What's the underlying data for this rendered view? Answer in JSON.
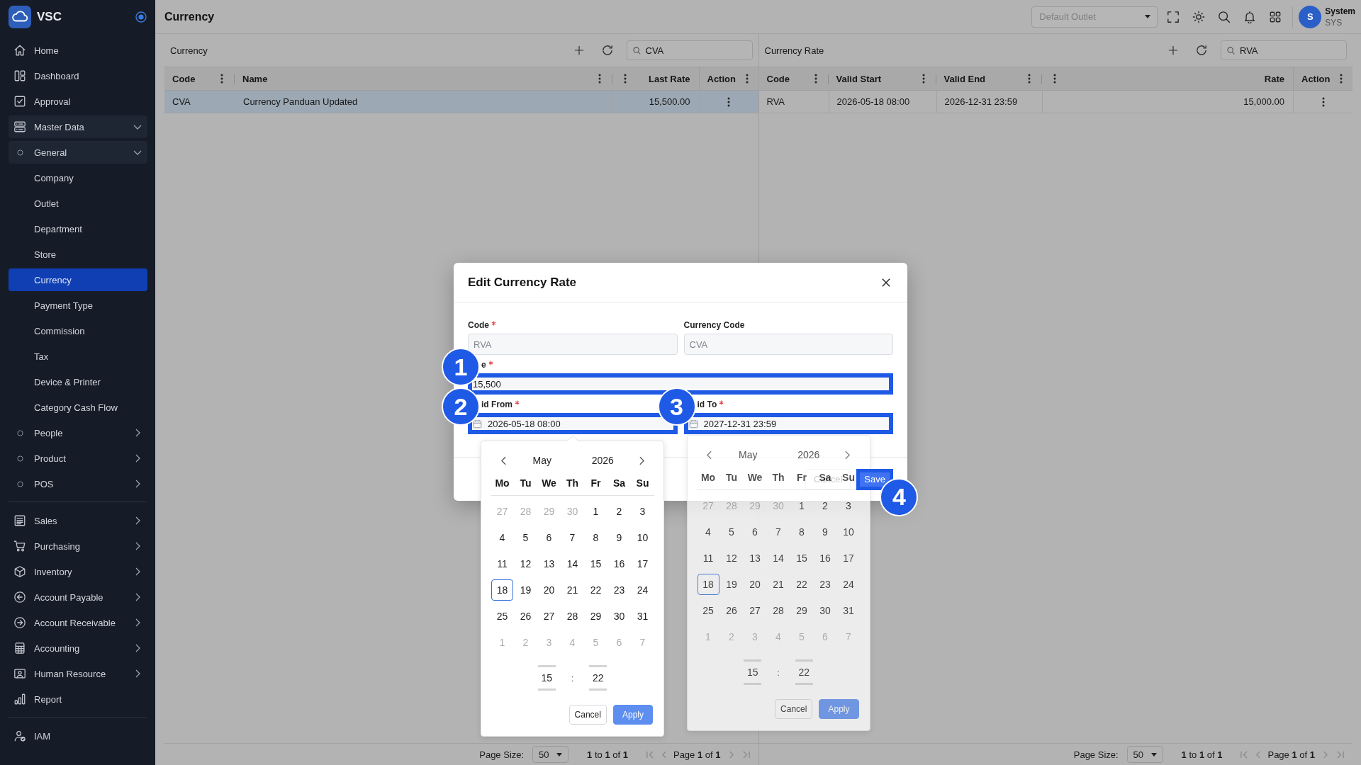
{
  "sidebar": {
    "brand": "VSC",
    "sections": [
      [
        {
          "label": "Home",
          "kind": "link",
          "selected": false
        },
        {
          "label": "Dashboard",
          "kind": "link",
          "selected": false
        },
        {
          "label": "Approval",
          "kind": "link",
          "selected": false
        },
        {
          "label": "Master Data",
          "kind": "group",
          "expanded": true,
          "children": [
            {
              "label": "General",
              "kind": "group",
              "expanded": true,
              "children": [
                {
                  "label": "Company",
                  "kind": "link",
                  "selected": false
                },
                {
                  "label": "Outlet",
                  "kind": "link",
                  "selected": false
                },
                {
                  "label": "Department",
                  "kind": "link",
                  "selected": false
                },
                {
                  "label": "Store",
                  "kind": "link",
                  "selected": false
                },
                {
                  "label": "Currency",
                  "kind": "link",
                  "selected": true
                },
                {
                  "label": "Payment Type",
                  "kind": "link",
                  "selected": false
                },
                {
                  "label": "Commission",
                  "kind": "link",
                  "selected": false
                },
                {
                  "label": "Tax",
                  "kind": "link",
                  "selected": false
                },
                {
                  "label": "Device & Printer",
                  "kind": "link",
                  "selected": false
                },
                {
                  "label": "Category Cash Flow",
                  "kind": "link",
                  "selected": false
                }
              ]
            },
            {
              "label": "People",
              "kind": "group",
              "expanded": false
            },
            {
              "label": "Product",
              "kind": "group",
              "expanded": false
            },
            {
              "label": "POS",
              "kind": "group",
              "expanded": false
            }
          ]
        }
      ],
      [
        {
          "label": "Sales",
          "kind": "group",
          "expanded": false
        },
        {
          "label": "Purchasing",
          "kind": "group",
          "expanded": false
        },
        {
          "label": "Inventory",
          "kind": "group",
          "expanded": false
        },
        {
          "label": "Account Payable",
          "kind": "group",
          "expanded": false
        },
        {
          "label": "Account Receivable",
          "kind": "group",
          "expanded": false
        },
        {
          "label": "Accounting",
          "kind": "group",
          "expanded": false
        },
        {
          "label": "Human Resource",
          "kind": "group",
          "expanded": false
        },
        {
          "label": "Report",
          "kind": "link",
          "selected": false
        }
      ],
      [
        {
          "label": "IAM",
          "kind": "link",
          "selected": false
        }
      ]
    ]
  },
  "topbar": {
    "title": "Currency",
    "outlet_select": {
      "placeholder": "Default Outlet"
    },
    "user": {
      "initial": "S",
      "name": "System",
      "role": "SYS"
    }
  },
  "panels": [
    {
      "title": "Currency",
      "search": {
        "value": "CVA"
      },
      "columns": [
        {
          "label": "Code",
          "kind": "text"
        },
        {
          "label": "Name",
          "kind": "text"
        },
        {
          "label": "Last Rate",
          "kind": "number"
        },
        {
          "label": "Action",
          "kind": "action"
        }
      ],
      "rows": [
        {
          "selected": true,
          "cells": [
            "CVA",
            "Currency Panduan Updated",
            "15,500.00"
          ]
        }
      ],
      "pagination": {
        "size_label": "Page Size:",
        "size": "50",
        "summary": "**1** to **1** of **1**",
        "page": "Page **1** of **1**",
        "nav": [
          {
            "kind": "first",
            "disabled": true
          },
          {
            "kind": "prev",
            "disabled": true
          },
          {
            "kind": "next",
            "disabled": true
          },
          {
            "kind": "last",
            "disabled": true
          }
        ]
      }
    },
    {
      "title": "Currency Rate",
      "search": {
        "value": "RVA"
      },
      "columns": [
        {
          "label": "Code",
          "kind": "text"
        },
        {
          "label": "Valid Start",
          "kind": "text"
        },
        {
          "label": "Valid End",
          "kind": "text"
        },
        {
          "label": "Rate",
          "kind": "number"
        },
        {
          "label": "Action",
          "kind": "action"
        }
      ],
      "rows": [
        {
          "selected": false,
          "cells": [
            "RVA",
            "2026-05-18 08:00",
            "2026-12-31 23:59",
            "15,000.00"
          ]
        }
      ],
      "pagination": {
        "size_label": "Page Size:",
        "size": "50",
        "summary": "**1** to **1** of **1**",
        "page": "Page **1** of **1**",
        "nav": [
          {
            "kind": "first",
            "disabled": true
          },
          {
            "kind": "prev",
            "disabled": true
          },
          {
            "kind": "next",
            "disabled": true
          },
          {
            "kind": "last",
            "disabled": true
          }
        ]
      }
    }
  ],
  "dialog": {
    "title": "Edit Currency Rate",
    "field_rows": [
      [
        {
          "label": "Code",
          "required": true,
          "kind": "text",
          "value": "RVA",
          "disabled": true
        },
        {
          "label": "Currency Code",
          "required": false,
          "kind": "text",
          "value": "CVA",
          "disabled": true
        }
      ],
      [
        {
          "label": "e",
          "required": true,
          "kind": "text",
          "value": "15,500",
          "disabled": false,
          "step": "1"
        }
      ],
      [
        {
          "label": "id From",
          "required": true,
          "kind": "date",
          "value": "2026-05-18 08:00",
          "disabled": false,
          "step": "2",
          "calendar": {
            "month": "May",
            "year": "2026",
            "weekdays": [
              "Mo",
              "Tu",
              "We",
              "Th",
              "Fr",
              "Sa",
              "Su"
            ],
            "days": [
              {
                "label": "27",
                "muted": true,
                "selected": false
              },
              {
                "label": "28",
                "muted": true,
                "selected": false
              },
              {
                "label": "29",
                "muted": true,
                "selected": false
              },
              {
                "label": "30",
                "muted": true,
                "selected": false
              },
              {
                "label": "1",
                "muted": false,
                "selected": false
              },
              {
                "label": "2",
                "muted": false,
                "selected": false
              },
              {
                "label": "3",
                "muted": false,
                "selected": false
              },
              {
                "label": "4",
                "muted": false,
                "selected": false
              },
              {
                "label": "5",
                "muted": false,
                "selected": false
              },
              {
                "label": "6",
                "muted": false,
                "selected": false
              },
              {
                "label": "7",
                "muted": false,
                "selected": false
              },
              {
                "label": "8",
                "muted": false,
                "selected": false
              },
              {
                "label": "9",
                "muted": false,
                "selected": false
              },
              {
                "label": "10",
                "muted": false,
                "selected": false
              },
              {
                "label": "11",
                "muted": false,
                "selected": false
              },
              {
                "label": "12",
                "muted": false,
                "selected": false
              },
              {
                "label": "13",
                "muted": false,
                "selected": false
              },
              {
                "label": "14",
                "muted": false,
                "selected": false
              },
              {
                "label": "15",
                "muted": false,
                "selected": false
              },
              {
                "label": "16",
                "muted": false,
                "selected": false
              },
              {
                "label": "17",
                "muted": false,
                "selected": false
              },
              {
                "label": "18",
                "muted": false,
                "selected": true
              },
              {
                "label": "19",
                "muted": false,
                "selected": false
              },
              {
                "label": "20",
                "muted": false,
                "selected": false
              },
              {
                "label": "21",
                "muted": false,
                "selected": false
              },
              {
                "label": "22",
                "muted": false,
                "selected": false
              },
              {
                "label": "23",
                "muted": false,
                "selected": false
              },
              {
                "label": "24",
                "muted": false,
                "selected": false
              },
              {
                "label": "25",
                "muted": false,
                "selected": false
              },
              {
                "label": "26",
                "muted": false,
                "selected": false
              },
              {
                "label": "27",
                "muted": false,
                "selected": false
              },
              {
                "label": "28",
                "muted": false,
                "selected": false
              },
              {
                "label": "29",
                "muted": false,
                "selected": false
              },
              {
                "label": "30",
                "muted": false,
                "selected": false
              },
              {
                "label": "31",
                "muted": false,
                "selected": false
              },
              {
                "label": "1",
                "muted": true,
                "selected": false
              },
              {
                "label": "2",
                "muted": true,
                "selected": false
              },
              {
                "label": "3",
                "muted": true,
                "selected": false
              },
              {
                "label": "4",
                "muted": true,
                "selected": false
              },
              {
                "label": "5",
                "muted": true,
                "selected": false
              },
              {
                "label": "6",
                "muted": true,
                "selected": false
              },
              {
                "label": "7",
                "muted": true,
                "selected": false
              }
            ],
            "hour": "15",
            "separator": ":",
            "minute": "22",
            "buttons": [
              {
                "label": "Cancel",
                "kind": "cancel"
              },
              {
                "label": "Apply",
                "kind": "apply"
              }
            ],
            "translucent": false,
            "arrow": true
          }
        },
        {
          "label": "id To",
          "required": true,
          "kind": "date",
          "value": "2027-12-31 23:59",
          "disabled": false,
          "step": "3",
          "calendar": {
            "month": "May",
            "year": "2026",
            "weekdays": [
              "Mo",
              "Tu",
              "We",
              "Th",
              "Fr",
              "Sa",
              "Su"
            ],
            "days": [
              {
                "label": "27",
                "muted": true,
                "selected": false
              },
              {
                "label": "28",
                "muted": true,
                "selected": false
              },
              {
                "label": "29",
                "muted": true,
                "selected": false
              },
              {
                "label": "30",
                "muted": true,
                "selected": false
              },
              {
                "label": "1",
                "muted": false,
                "selected": false
              },
              {
                "label": "2",
                "muted": false,
                "selected": false
              },
              {
                "label": "3",
                "muted": false,
                "selected": false
              },
              {
                "label": "4",
                "muted": false,
                "selected": false
              },
              {
                "label": "5",
                "muted": false,
                "selected": false
              },
              {
                "label": "6",
                "muted": false,
                "selected": false
              },
              {
                "label": "7",
                "muted": false,
                "selected": false
              },
              {
                "label": "8",
                "muted": false,
                "selected": false
              },
              {
                "label": "9",
                "muted": false,
                "selected": false
              },
              {
                "label": "10",
                "muted": false,
                "selected": false
              },
              {
                "label": "11",
                "muted": false,
                "selected": false
              },
              {
                "label": "12",
                "muted": false,
                "selected": false
              },
              {
                "label": "13",
                "muted": false,
                "selected": false
              },
              {
                "label": "14",
                "muted": false,
                "selected": false
              },
              {
                "label": "15",
                "muted": false,
                "selected": false
              },
              {
                "label": "16",
                "muted": false,
                "selected": false
              },
              {
                "label": "17",
                "muted": false,
                "selected": false
              },
              {
                "label": "18",
                "muted": false,
                "selected": true
              },
              {
                "label": "19",
                "muted": false,
                "selected": false
              },
              {
                "label": "20",
                "muted": false,
                "selected": false
              },
              {
                "label": "21",
                "muted": false,
                "selected": false
              },
              {
                "label": "22",
                "muted": false,
                "selected": false
              },
              {
                "label": "23",
                "muted": false,
                "selected": false
              },
              {
                "label": "24",
                "muted": false,
                "selected": false
              },
              {
                "label": "25",
                "muted": false,
                "selected": false
              },
              {
                "label": "26",
                "muted": false,
                "selected": false
              },
              {
                "label": "27",
                "muted": false,
                "selected": false
              },
              {
                "label": "28",
                "muted": false,
                "selected": false
              },
              {
                "label": "29",
                "muted": false,
                "selected": false
              },
              {
                "label": "30",
                "muted": false,
                "selected": false
              },
              {
                "label": "31",
                "muted": false,
                "selected": false
              },
              {
                "label": "1",
                "muted": true,
                "selected": false
              },
              {
                "label": "2",
                "muted": true,
                "selected": false
              },
              {
                "label": "3",
                "muted": true,
                "selected": false
              },
              {
                "label": "4",
                "muted": true,
                "selected": false
              },
              {
                "label": "5",
                "muted": true,
                "selected": false
              },
              {
                "label": "6",
                "muted": true,
                "selected": false
              },
              {
                "label": "7",
                "muted": true,
                "selected": false
              }
            ],
            "hour": "15",
            "separator": ":",
            "minute": "22",
            "buttons": [
              {
                "label": "Cancel",
                "kind": "cancel"
              },
              {
                "label": "Apply",
                "kind": "apply"
              }
            ],
            "translucent": true,
            "arrow": false
          }
        }
      ]
    ],
    "buttons": [
      {
        "label": "Cancel",
        "kind": "cancel"
      },
      {
        "label": "Save",
        "kind": "save",
        "step": "4"
      }
    ]
  }
}
